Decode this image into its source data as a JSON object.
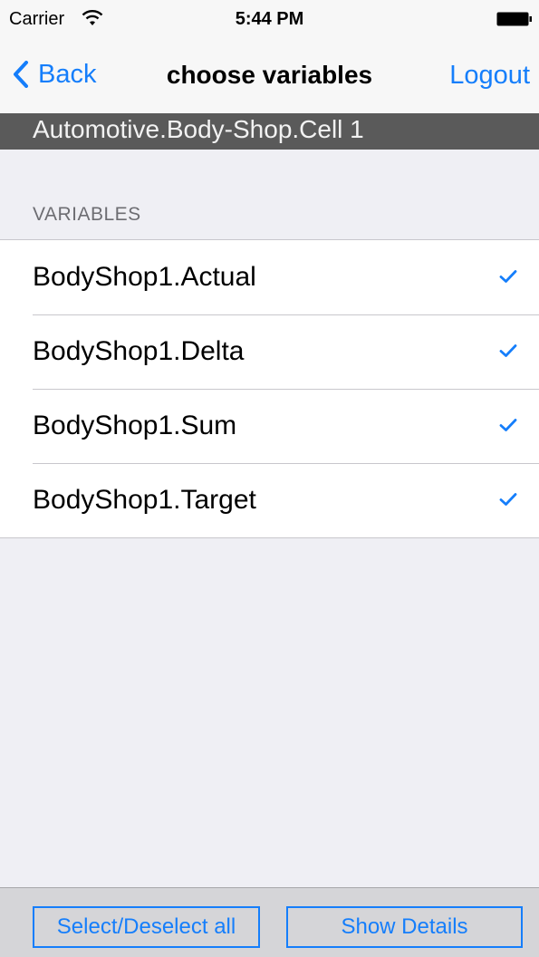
{
  "status_bar": {
    "carrier": "Carrier",
    "time": "5:44 PM"
  },
  "nav": {
    "back_label": "Back",
    "title": "choose variables",
    "logout_label": "Logout"
  },
  "path": "Automotive.Body-Shop.Cell 1",
  "section": {
    "header": "VARIABLES",
    "items": [
      {
        "label": "BodyShop1.Actual",
        "checked": true
      },
      {
        "label": "BodyShop1.Delta",
        "checked": true
      },
      {
        "label": "BodyShop1.Sum",
        "checked": true
      },
      {
        "label": "BodyShop1.Target",
        "checked": true
      }
    ]
  },
  "toolbar": {
    "select_all_label": "Select/Deselect all",
    "show_details_label": "Show Details"
  },
  "colors": {
    "accent": "#157efb",
    "path_header_bg": "#5a5a5a",
    "background": "#efeff4"
  }
}
